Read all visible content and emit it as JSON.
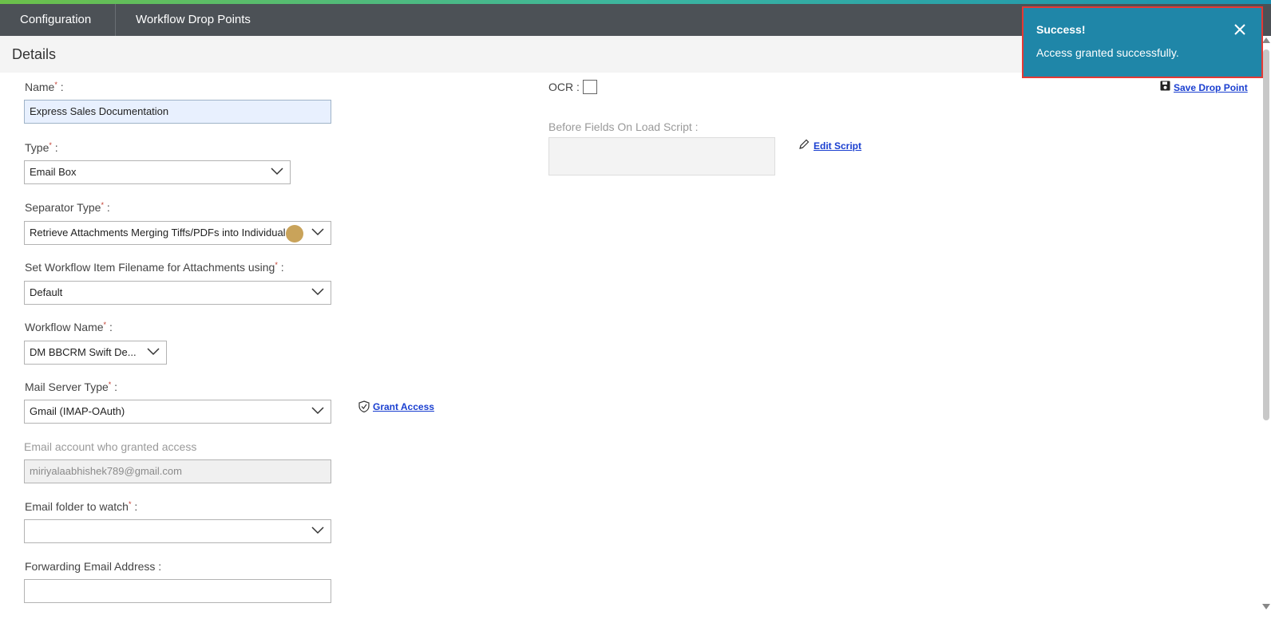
{
  "topbar": {
    "tab1": "Configuration",
    "tab2": "Workflow Drop Points"
  },
  "details": {
    "title": "Details"
  },
  "form": {
    "name": {
      "label": "Name",
      "suffix": " :",
      "value": "Express Sales Documentation"
    },
    "type": {
      "label": "Type",
      "suffix": " :",
      "value": "Email Box"
    },
    "separator": {
      "label": "Separator Type",
      "suffix": " :",
      "value": "Retrieve Attachments Merging Tiffs/PDFs into Individual"
    },
    "filename": {
      "label": "Set Workflow Item Filename for Attachments using",
      "suffix": " :",
      "value": "Default"
    },
    "workflow": {
      "label": "Workflow Name",
      "suffix": " :",
      "value": "DM BBCRM Swift De..."
    },
    "mailserver": {
      "label": "Mail Server Type",
      "suffix": " :",
      "value": "Gmail (IMAP-OAuth)"
    },
    "email_account": {
      "label": "Email account who granted access",
      "value": "miriyalaabhishek789@gmail.com"
    },
    "folder": {
      "label": "Email folder to watch",
      "suffix": " :",
      "value": ""
    },
    "forwarding": {
      "label": "Forwarding Email Address :",
      "value": ""
    },
    "required_mark": "*"
  },
  "right": {
    "ocr_label": "OCR :",
    "script_label": "Before Fields On Load Script :",
    "edit_script": "Edit Script",
    "save_drop_point": "Save Drop Point",
    "grant_access": "Grant Access"
  },
  "toast": {
    "title": "Success!",
    "message": "Access granted successfully."
  },
  "colors": {
    "topbar": "#4c5156",
    "toast": "#1f86a8",
    "link": "#1a3fd0",
    "highlight": "#e53935"
  }
}
